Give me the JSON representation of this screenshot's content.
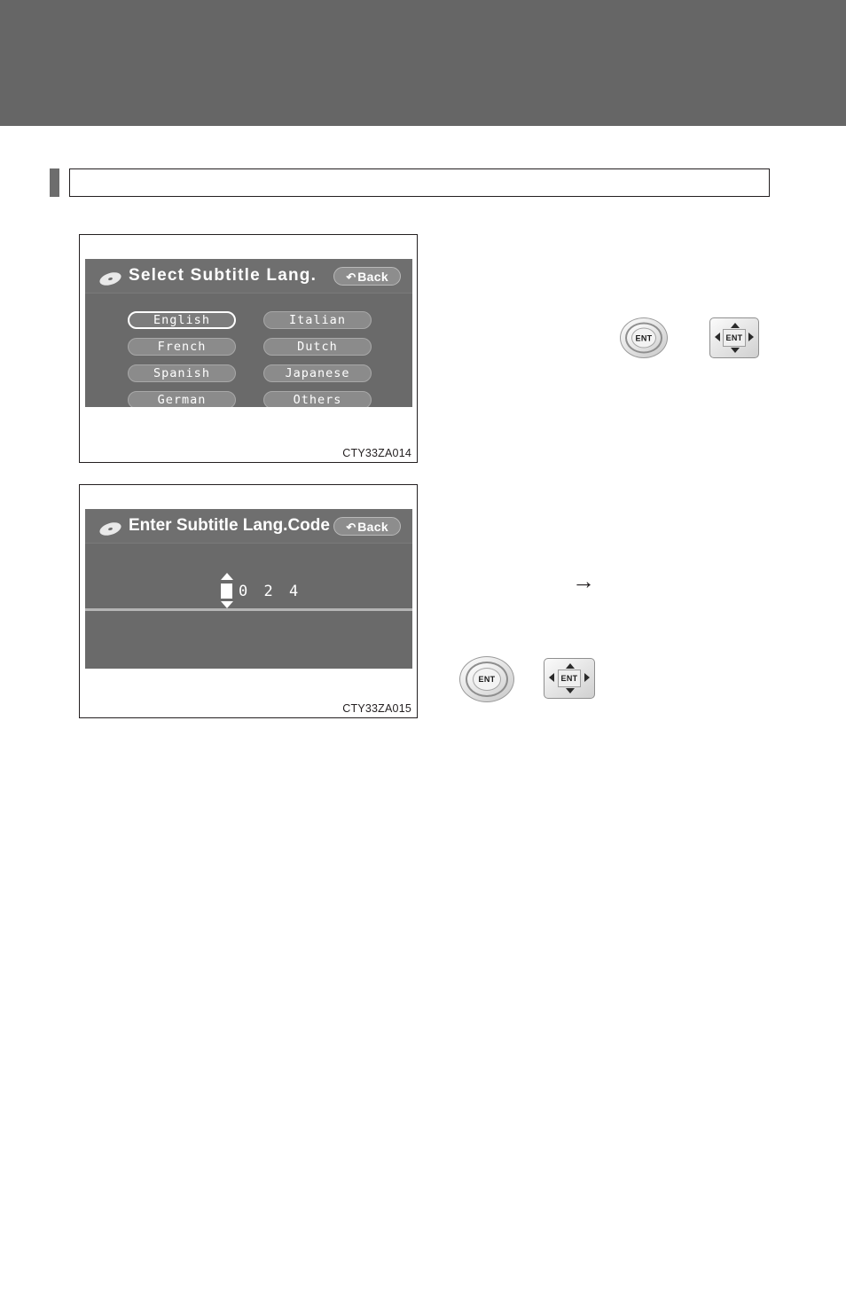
{
  "page": {
    "header_band_color": "#666666",
    "background_color": "#ffffff"
  },
  "section": {
    "title": ""
  },
  "figures": [
    {
      "id": "fig1",
      "caption": "CTY33ZA014",
      "screen": {
        "title": "Select  Subtitle  Lang.",
        "disc_icon": "disc-icon",
        "back_label": "Back",
        "back_icon": "back-arrow-icon",
        "buttons": [
          {
            "label": "English",
            "selected": true
          },
          {
            "label": "Italian",
            "selected": false
          },
          {
            "label": "French",
            "selected": false
          },
          {
            "label": "Dutch",
            "selected": false
          },
          {
            "label": "Spanish",
            "selected": false
          },
          {
            "label": "Japanese",
            "selected": false
          },
          {
            "label": "German",
            "selected": false
          },
          {
            "label": "Others",
            "selected": false
          }
        ]
      }
    },
    {
      "id": "fig2",
      "caption": "CTY33ZA015",
      "screen": {
        "title": "Enter Subtitle Lang.Code",
        "disc_icon": "disc-icon",
        "back_label": "Back",
        "back_icon": "back-arrow-icon",
        "code_value": "0 2 4"
      }
    }
  ],
  "controls": {
    "ent_label": "ENT",
    "arrow_up": "▲",
    "arrow_down": "▼",
    "arrow_left": "◀",
    "arrow_right": "▶",
    "step_arrow": "→"
  }
}
